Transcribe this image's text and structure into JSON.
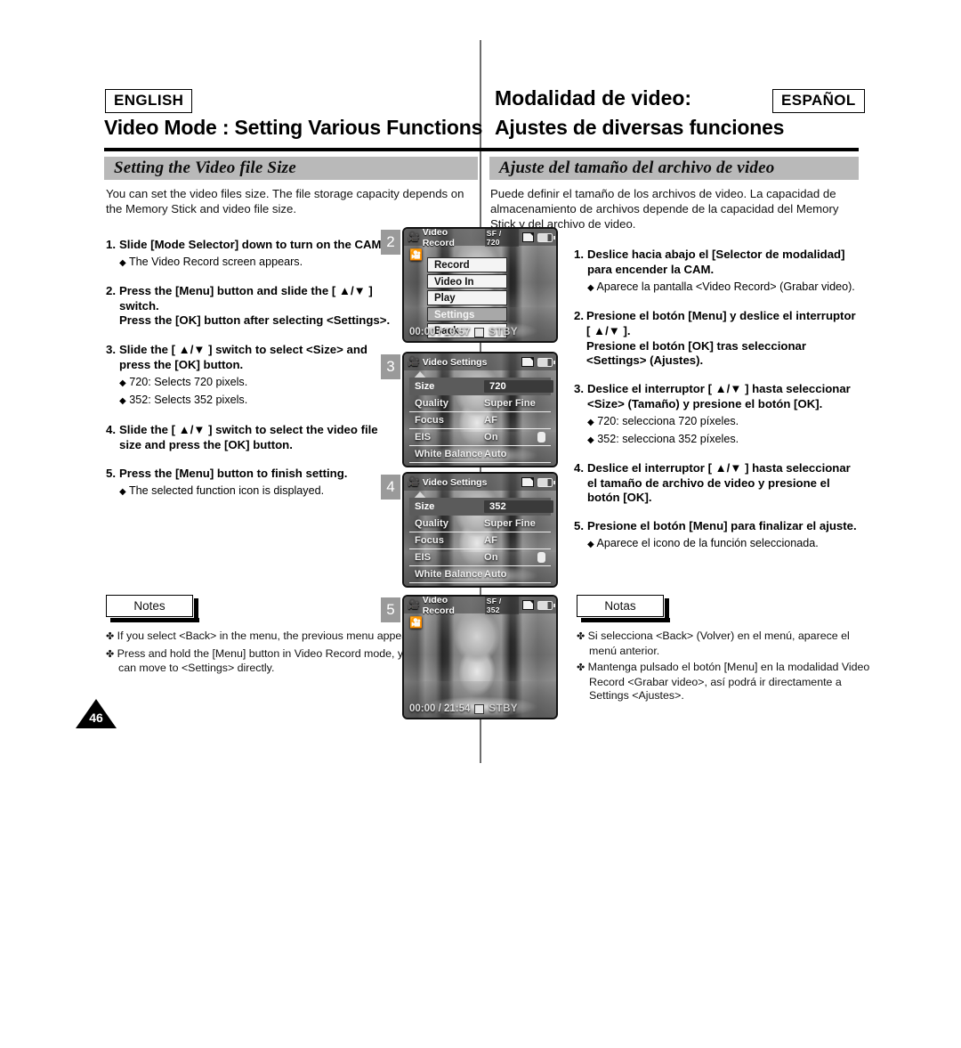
{
  "header": {
    "english_badge": "ENGLISH",
    "spanish_badge": "ESPAÑOL",
    "english_title": "Video Mode : Setting Various Functions",
    "spanish_title_top": "Modalidad de video:",
    "spanish_title_sub": "Ajustes de diversas funciones"
  },
  "section": {
    "english": "Setting the Video file Size",
    "spanish": "Ajuste del tamaño del archivo de video"
  },
  "english": {
    "intro": "You can set the video files size. The file storage capacity depends on the Memory Stick and video file size.",
    "steps": [
      {
        "num": "1.",
        "text": "Slide [Mode Selector] down to turn on the CAM.",
        "bullets": [
          "The Video Record screen appears."
        ]
      },
      {
        "num": "2.",
        "text": "Press the [Menu] button and slide the [ ▲/▼ ] switch.",
        "text2": "Press the [OK] button after selecting <Settings>.",
        "bullets": []
      },
      {
        "num": "3.",
        "text": "Slide the [ ▲/▼ ] switch to select <Size> and press the [OK] button.",
        "bullets": [
          "720: Selects 720 pixels.",
          "352: Selects 352 pixels."
        ]
      },
      {
        "num": "4.",
        "text": "Slide the [ ▲/▼ ] switch to select the video file size and press the [OK] button.",
        "bullets": []
      },
      {
        "num": "5.",
        "text": "Press the [Menu] button to finish setting.",
        "bullets": [
          "The selected function icon is displayed."
        ]
      }
    ],
    "notes_label": "Notes",
    "notes": [
      "If you select <Back> in the menu, the previous menu appears.",
      "Press and hold the [Menu] button in Video Record mode, you can move to <Settings> directly."
    ]
  },
  "spanish": {
    "intro": "Puede definir el tamaño de los archivos de video. La capacidad de almacenamiento de archivos depende de la capacidad del Memory Stick y del archivo de video.",
    "steps": [
      {
        "num": "1.",
        "text": "Deslice hacia abajo el [Selector de modalidad] para encender la CAM.",
        "bullets": [
          "Aparece la pantalla <Video Record> (Grabar video)."
        ]
      },
      {
        "num": "2.",
        "text": "Presione el botón [Menu] y deslice el interruptor [ ▲/▼ ].",
        "text2": "Presione el botón [OK] tras seleccionar <Settings> (Ajustes).",
        "bullets": []
      },
      {
        "num": "3.",
        "text": "Deslice el interruptor [ ▲/▼ ] hasta seleccionar <Size> (Tamaño) y presione el botón [OK].",
        "bullets": [
          "720: selecciona 720 píxeles.",
          "352: selecciona 352 píxeles."
        ]
      },
      {
        "num": "4.",
        "text": "Deslice el interruptor [ ▲/▼ ] hasta seleccionar el tamaño de archivo de video y presione el botón [OK].",
        "bullets": []
      },
      {
        "num": "5.",
        "text": "Presione el botón [Menu] para finalizar el ajuste.",
        "bullets": [
          "Aparece el icono de la función seleccionada."
        ]
      }
    ],
    "notes_label": "Notas",
    "notes": [
      "Si selecciona <Back> (Volver) en el menú, aparece el menú anterior.",
      "Mantenga pulsado el botón [Menu] en la modalidad Video Record <Grabar video>, así podrá ir directamente a Settings <Ajustes>."
    ]
  },
  "screenshots": [
    {
      "badge": "2",
      "kind": "menu",
      "lcd_mode": "Video Record",
      "lcd_quality": "SF",
      "lcd_size": "720",
      "timecode": "00:00 / 10:57",
      "status": "STBY",
      "menu_items": [
        {
          "label": "Record",
          "selected": false
        },
        {
          "label": "Video In",
          "selected": false
        },
        {
          "label": "Play",
          "selected": false
        },
        {
          "label": "Settings",
          "selected": true
        },
        {
          "label": "Back",
          "selected": false
        }
      ]
    },
    {
      "badge": "3",
      "kind": "settings",
      "lcd_mode": "Video Settings",
      "rows": [
        {
          "label": "Size",
          "value": "720",
          "highlight": true
        },
        {
          "label": "Quality",
          "value": "Super Fine",
          "highlight": false
        },
        {
          "label": "Focus",
          "value": "AF",
          "highlight": false
        },
        {
          "label": "EIS",
          "value": "On",
          "highlight": false
        },
        {
          "label": "White Balance",
          "value": "Auto",
          "highlight": false
        }
      ]
    },
    {
      "badge": "4",
      "kind": "settings",
      "lcd_mode": "Video Settings",
      "rows": [
        {
          "label": "Size",
          "value": "352",
          "highlight": true
        },
        {
          "label": "Quality",
          "value": "Super Fine",
          "highlight": false
        },
        {
          "label": "Focus",
          "value": "AF",
          "highlight": false
        },
        {
          "label": "EIS",
          "value": "On",
          "highlight": false
        },
        {
          "label": "White Balance",
          "value": "Auto",
          "highlight": false
        }
      ]
    },
    {
      "badge": "5",
      "kind": "record",
      "lcd_mode": "Video Record",
      "lcd_quality": "SF",
      "lcd_size": "352",
      "timecode": "00:00 / 21:54",
      "status": "STBY"
    }
  ],
  "page_number": "46",
  "colors": {
    "section_bar": "#b9b9b9",
    "badge_gray": "#9a9a9a",
    "rule": "#000000"
  }
}
